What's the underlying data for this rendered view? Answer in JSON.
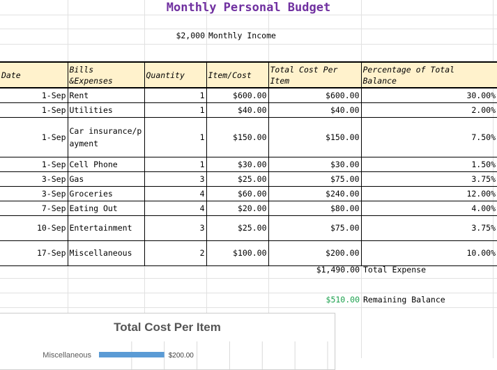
{
  "title": "Monthly Personal Budget",
  "income": {
    "value": "$2,000",
    "label": "Monthly Income"
  },
  "table": {
    "headers": [
      "Date",
      "Bills\n&Expenses",
      "Quantity",
      "Item/Cost",
      "Total Cost Per\nItem",
      "Percentage of Total\nBalance"
    ],
    "rows": [
      [
        "1-Sep",
        "Rent",
        "1",
        "$600.00",
        "$600.00",
        "30.00%"
      ],
      [
        "1-Sep",
        "Utilities",
        "1",
        "$40.00",
        "$40.00",
        "2.00%"
      ],
      [
        "1-Sep",
        "Car insurance/payment",
        "1",
        "$150.00",
        "$150.00",
        "7.50%"
      ],
      [
        "1-Sep",
        "Cell Phone",
        "1",
        "$30.00",
        "$30.00",
        "1.50%"
      ],
      [
        "3-Sep",
        "Gas",
        "3",
        "$25.00",
        "$75.00",
        "3.75%"
      ],
      [
        "3-Sep",
        "Groceries",
        "4",
        "$60.00",
        "$240.00",
        "12.00%"
      ],
      [
        "7-Sep",
        "Eating Out",
        "4",
        "$20.00",
        "$80.00",
        "4.00%"
      ],
      [
        "10-Sep",
        "Entertainment",
        "3",
        "$25.00",
        "$75.00",
        "3.75%"
      ],
      [
        "17-Sep",
        "Miscellaneous",
        "2",
        "$100.00",
        "$200.00",
        "10.00%"
      ]
    ]
  },
  "total_expense": {
    "value": "$1,490.00",
    "label": "Total Expense"
  },
  "remaining_balance": {
    "value": "$510.00",
    "label": "Remaining Balance"
  },
  "colors": {
    "title": "#7030a0",
    "header_fill": "#fff2cc",
    "remaining": "#1aa04c",
    "bar": "#5b9bd5"
  },
  "chart_data": {
    "type": "bar",
    "orientation": "horizontal",
    "title": "Total Cost Per Item",
    "categories": [
      "Miscellaneous"
    ],
    "values": [
      200
    ],
    "data_labels": [
      "$200.00"
    ],
    "xlim": [
      0,
      700
    ],
    "grid": true
  }
}
